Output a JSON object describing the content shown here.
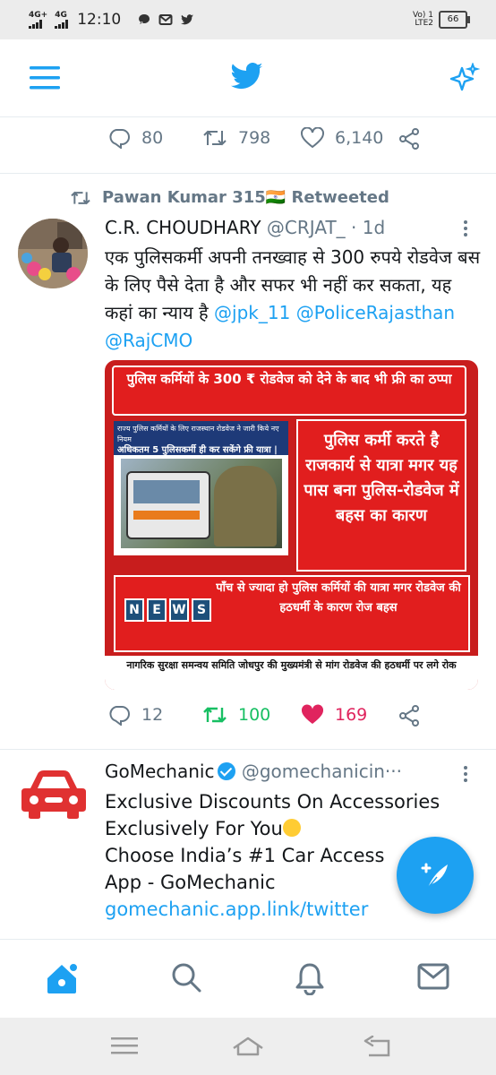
{
  "status_bar": {
    "network_1": "4G+",
    "network_2": "4G",
    "time": "12:10",
    "volte_label": "Vo) 1",
    "lte_label": "LTE2",
    "battery": "66"
  },
  "app_bar": {
    "menu_icon": "menu-icon",
    "logo_icon": "twitter-bird-icon",
    "sparkle_icon": "sparkle-icon"
  },
  "prev_tweet_actions": {
    "replies": "80",
    "retweets": "798",
    "likes": "6,140"
  },
  "tweet": {
    "retweeted_by": "Pawan Kumar 315🇮🇳 Retweeted",
    "author_name": "C.R. CHOUDHARY",
    "author_handle": "@CRJAT_",
    "separator": "·",
    "time_ago": "1d",
    "text_main": "एक पुलिसकर्मी अपनी तनख्वाह से 300 रुपये रोडवेज बस के लिए पैसे देता है और सफर भी नहीं कर सकता, यह कहां का न्याय है ",
    "mention_1": "@jpk_11",
    "mention_2": "@PoliceRajasthan",
    "mention_3": "@RajCMO",
    "media": {
      "banner_top": "पुलिस कर्मियों के 300 ₹ रोडवेज को देने के बाद भी फ्री का ठप्पा",
      "photo_caption_line1": "राज्य पुलिस कर्मियों के लिए राजस्थान रोडवेज ने जारी किये नए नियम",
      "photo_caption_line2": "अधिकतम 5 पुलिसकर्मी ही कर सकेंगे फ्री यात्रा |",
      "right_box": "पुलिस कर्मी करते है राजकार्य से यात्रा मगर यह पास बना पुलिस-रोडवेज में बहस का कारण",
      "news_letters": [
        "N",
        "E",
        "W",
        "S"
      ],
      "bottom_box": "पाँच से ज्यादा हो पुलिस कर्मियों की यात्रा मगर रोडवेज की हठधर्मी के कारण रोज बहस",
      "ticker": "नागरिक सुरक्षा समन्वय समिति जोधपुर की मुख्यमंत्री से मांग रोडवेज की हठधर्मी पर लगे रोक"
    },
    "replies": "12",
    "retweets": "100",
    "likes": "169",
    "retweet_color": "#17bf63",
    "like_color": "#e0245e"
  },
  "ad_tweet": {
    "author_name": "GoMechanic",
    "author_handle": "@gomechanicin···",
    "line_1": "Exclusive Discounts On Accessories",
    "line_2": "Exclusively For You",
    "line_3": "Choose India’s #1 Car Access",
    "line_4": "App - GoMechanic",
    "link": "gomechanic.app.link/twitter",
    "logo_color": "#e03131"
  },
  "colors": {
    "accent": "#1da1f2",
    "muted": "#657786"
  },
  "bottom_nav": [
    "home-icon",
    "search-icon",
    "notifications-icon",
    "messages-icon"
  ],
  "system_nav": [
    "menu-lines-icon",
    "home-outline-icon",
    "back-icon"
  ]
}
